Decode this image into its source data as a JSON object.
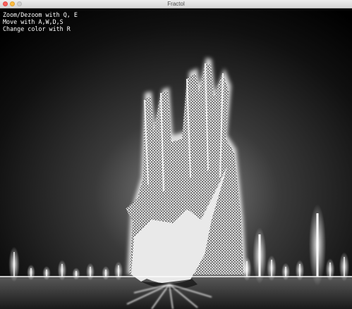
{
  "window": {
    "title": "Fractol"
  },
  "controls_help": [
    "Zoom/Dezoom with Q, E",
    "Move with A,W,D,S",
    "Change color with R"
  ],
  "colors": {
    "background": "#000000",
    "glow": "#ffffff",
    "text": "#ffffff"
  }
}
